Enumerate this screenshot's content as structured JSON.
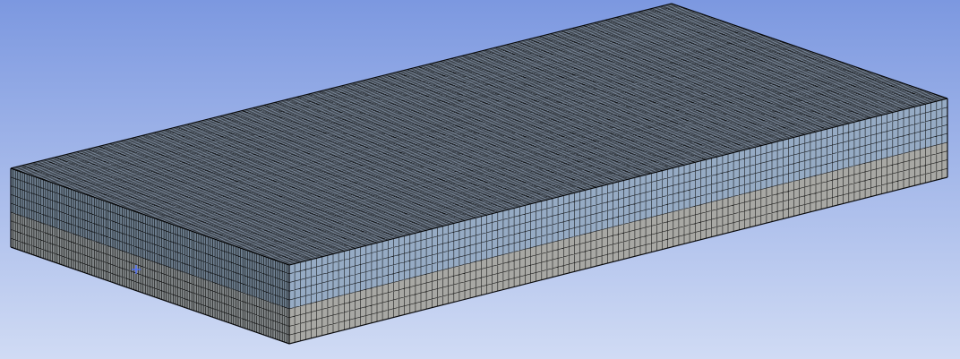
{
  "viewport": {
    "background_top": "#7c98e0",
    "background_bottom": "#d0dbf4"
  },
  "model": {
    "type": "hexahedral-mesh-block",
    "mesh_line_color": "#000000",
    "top_face_color": "#7d8b9d",
    "left_face_upper_color": "#6f8091",
    "left_face_lower_color": "#858a8c",
    "front_face_upper_color": "#96abc4",
    "front_face_lower_color": "#a8a8a4",
    "top_divisions_long": 120,
    "top_divisions_short": 60,
    "height_divisions_upper": 5,
    "height_divisions_lower": 4
  },
  "cursor": {
    "icon": "crosshair-icon",
    "color": "#4a6cff"
  }
}
